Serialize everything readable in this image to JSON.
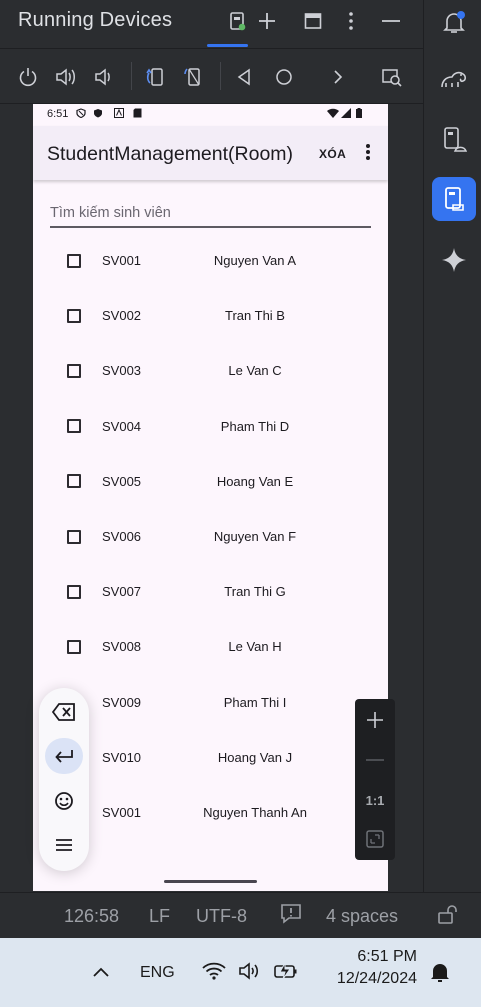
{
  "panel": {
    "title": "Running Devices",
    "header_icons": [
      "device-tab-icon",
      "add-icon",
      "window-icon",
      "more-vert-icon",
      "minimize-icon"
    ]
  },
  "device_toolbar": {
    "icons": [
      "power-icon",
      "volume-up-icon",
      "volume-down-icon",
      "rotate-left-icon",
      "rotate-right-icon",
      "back-icon",
      "home-icon",
      "overview-icon",
      "screenshot-icon"
    ]
  },
  "phone": {
    "status_time": "6:51",
    "app_title": "StudentManagement(Room)",
    "delete_label": "XÓA",
    "search_placeholder": "Tìm kiếm sinh viên",
    "students": [
      {
        "id": "SV001",
        "name": "Nguyen Van A"
      },
      {
        "id": "SV002",
        "name": "Tran Thi B"
      },
      {
        "id": "SV003",
        "name": "Le Van C"
      },
      {
        "id": "SV004",
        "name": "Pham Thi D"
      },
      {
        "id": "SV005",
        "name": "Hoang Van E"
      },
      {
        "id": "SV006",
        "name": "Nguyen Van F"
      },
      {
        "id": "SV007",
        "name": "Tran Thi G"
      },
      {
        "id": "SV008",
        "name": "Le Van H"
      },
      {
        "id": "SV009",
        "name": "Pham Thi I"
      },
      {
        "id": "SV010",
        "name": "Hoang Van J"
      },
      {
        "id": "SV001",
        "name": "Nguyen Thanh An"
      }
    ]
  },
  "zoom": {
    "fit_label": "1:1"
  },
  "ide_status": {
    "position": "126:58",
    "line_ending": "LF",
    "encoding": "UTF-8",
    "indent": "4 spaces"
  },
  "taskbar": {
    "language": "ENG",
    "time": "6:51 PM",
    "date": "12/24/2024"
  },
  "colors": {
    "accent": "#3574f0",
    "device_bg": "#fdf6fd",
    "appbar_bg": "#f3edf7",
    "ide_bg": "#2b2d30"
  }
}
